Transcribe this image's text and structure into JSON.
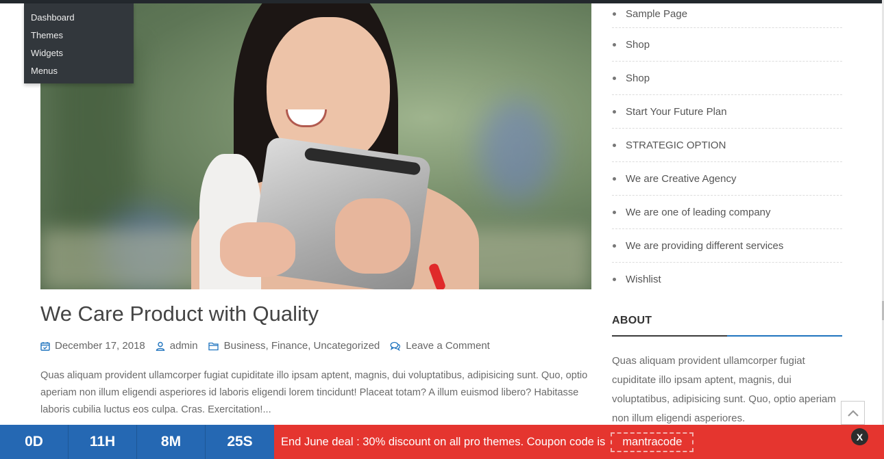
{
  "admin_menu": {
    "items": [
      {
        "label": "Dashboard"
      },
      {
        "label": "Themes"
      },
      {
        "label": "Widgets"
      },
      {
        "label": "Menus"
      }
    ]
  },
  "post": {
    "title": "We Care Product with Quality",
    "date": "December 17, 2018",
    "author": "admin",
    "categories": [
      "Business",
      "Finance",
      "Uncategorized"
    ],
    "comment_link": "Leave a Comment",
    "excerpt": "Quas aliquam provident ullamcorper fugiat cupiditate illo ipsam aptent, magnis, dui voluptatibus, adipisicing sunt. Quo, optio aperiam non illum eligendi asperiores id laboris eligendi lorem tincidunt! Placeat totam? A illum euismod libero? Habitasse laboris cubilia luctus eos culpa. Cras. Exercitation!..."
  },
  "sidebar": {
    "pages": [
      {
        "label": "Sample Page"
      },
      {
        "label": "Shop"
      },
      {
        "label": "Shop"
      },
      {
        "label": "Start Your Future Plan"
      },
      {
        "label": "STRATEGIC OPTION"
      },
      {
        "label": "We are Creative Agency"
      },
      {
        "label": "We are one of leading company"
      },
      {
        "label": "We are providing different services"
      },
      {
        "label": "Wishlist"
      }
    ],
    "about_title": "ABOUT",
    "about_text": "Quas aliquam provident ullamcorper fugiat cupiditate illo ipsam aptent, magnis, dui voluptatibus, adipisicing sunt. Quo, optio aperiam non illum eligendi asperiores."
  },
  "deal_bar": {
    "countdown": {
      "days": "0D",
      "hours": "11H",
      "minutes": "8M",
      "seconds": "25S"
    },
    "message": "End June deal : 30% discount on all pro themes. Coupon code is",
    "coupon": "mantracode",
    "close_label": "X"
  },
  "colors": {
    "accent_blue": "#2568b3",
    "deal_red": "#e5352f",
    "admin_dark": "#32373c"
  },
  "icons": {
    "date": "calendar-icon",
    "author": "user-icon",
    "category": "folder-icon",
    "comment": "comments-icon",
    "to_top": "chevron-up-icon"
  }
}
